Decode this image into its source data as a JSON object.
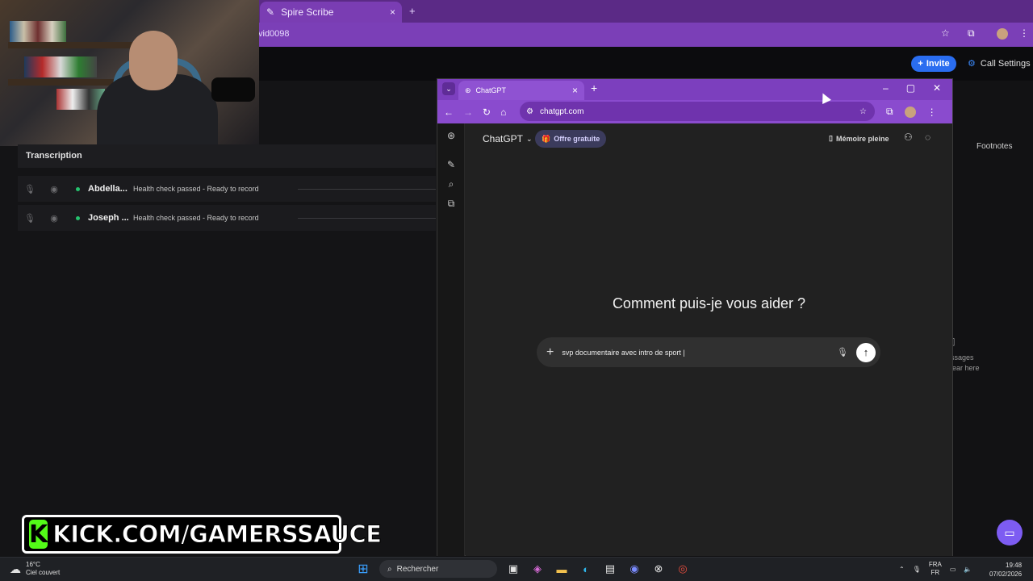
{
  "background_browser": {
    "tab_title": "Spire Scribe",
    "url_fragment": "vid0098"
  },
  "meeting": {
    "invite_label": "Invite",
    "call_settings_label": "Call Settings",
    "transcription_title": "Transcription",
    "participants": [
      {
        "name": "Abdella...",
        "status": "Health check passed - Ready to record"
      },
      {
        "name": "Joseph ...",
        "status": "Health check passed - Ready to record"
      }
    ],
    "footnotes_label": "Footnotes",
    "messages_partial": "ssages",
    "clear_partial": "ear here"
  },
  "stream_banner": {
    "logo_letter": "K",
    "text": "KICK.COM/GAMERSSAUCE"
  },
  "chatgpt_window": {
    "tab_title": "ChatGPT",
    "url": "chatgpt.com",
    "model_label": "ChatGPT",
    "offer_label": "Offre gratuite",
    "memory_label": "Mémoire pleine",
    "heading": "Comment puis-je vous aider ?",
    "composer_value": "svp documentaire avec intro de sport |"
  },
  "taskbar": {
    "temperature": "16°C",
    "weather_desc": "Ciel couvert",
    "search_placeholder": "Rechercher",
    "lang_top": "FRA",
    "lang_bottom": "FR",
    "time": "19:48",
    "date": "07/02/2026"
  },
  "icons": [
    "close-icon",
    "plus-icon",
    "star-icon",
    "extensions-icon",
    "menu-icon",
    "back-icon",
    "forward-icon",
    "reload-icon",
    "home-icon",
    "site-info-icon",
    "openai-logo-icon",
    "new-chat-icon",
    "search-icon",
    "library-icon",
    "memory-icon",
    "user-icon",
    "temporary-chat-icon",
    "mic-icon",
    "send-icon",
    "windows-start-icon",
    "chat-bubble-icon"
  ],
  "colors": {
    "browser_purple": "#7c3fbe",
    "invite_blue": "#2a6df0",
    "kick_green": "#53fc18",
    "status_green": "#25c26e",
    "support_violet": "#7d5cf2"
  }
}
